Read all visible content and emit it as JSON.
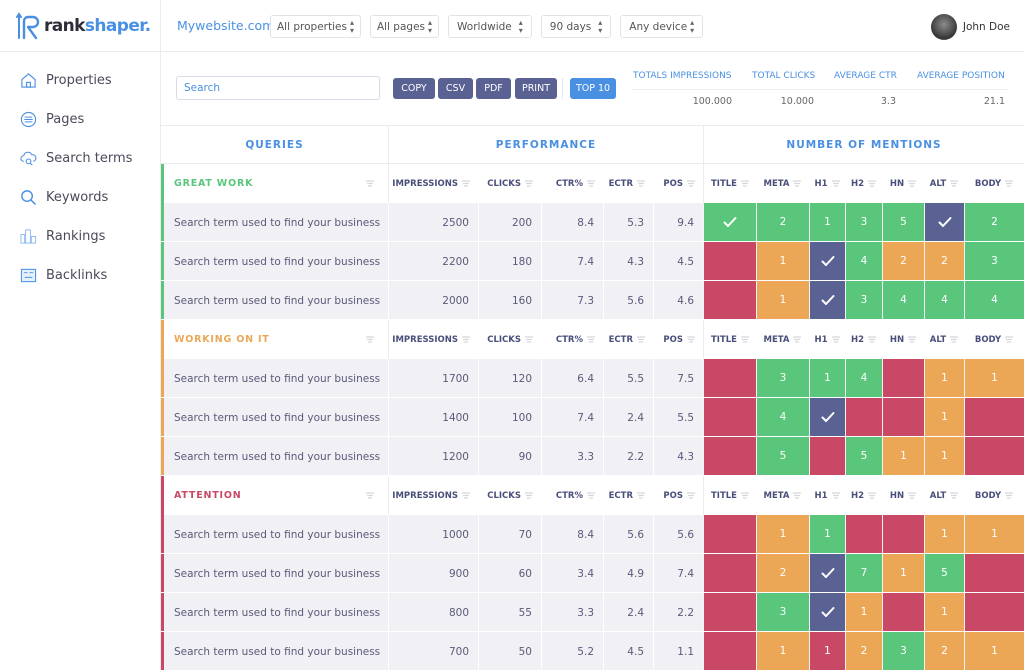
{
  "app": {
    "logo_rank": "rank",
    "logo_shaper": "shaper.",
    "site_name": "Mywebsite.com",
    "filters": [
      {
        "label": "All properties"
      },
      {
        "label": "All pages"
      },
      {
        "label": "Worldwide"
      },
      {
        "label": "90 days"
      },
      {
        "label": "Any device"
      }
    ],
    "user_name": "John Doe"
  },
  "sidebar": {
    "items": [
      {
        "label": "Properties",
        "icon": "home-icon"
      },
      {
        "label": "Pages",
        "icon": "list-icon"
      },
      {
        "label": "Search terms",
        "icon": "cloud-search-icon"
      },
      {
        "label": "Keywords",
        "icon": "search-icon"
      },
      {
        "label": "Rankings",
        "icon": "rankings-icon"
      },
      {
        "label": "Backlinks",
        "icon": "backlinks-icon"
      }
    ]
  },
  "toolbar": {
    "search_placeholder": "Search",
    "buttons": [
      "COPY",
      "CSV",
      "PDF",
      "PRINT"
    ],
    "top10": "TOP 10"
  },
  "stats": [
    {
      "label": "TOTALS IMPRESSIONS",
      "value": "100.000"
    },
    {
      "label": "TOTAL CLICKS",
      "value": "10.000"
    },
    {
      "label": "AVERAGE CTR",
      "value": "3.3"
    },
    {
      "label": "AVERAGE POSITION",
      "value": "21.1"
    }
  ],
  "table": {
    "groups": [
      "QUERIES",
      "PERFORMANCE",
      "NUMBER OF MENTIONS"
    ],
    "perf_columns": [
      "IMPRESSIONS",
      "CLICKS",
      "CTR%",
      "ECTR",
      "POS"
    ],
    "mention_columns": [
      "TITLE",
      "META",
      "H1",
      "H2",
      "HN",
      "ALT",
      "BODY"
    ],
    "colors": {
      "green": "#5ac67c",
      "orange": "#eba755",
      "red": "#c84866",
      "navy": "#5a6294"
    },
    "sections": [
      {
        "title": "GREAT WORK",
        "color": "#5ac67c",
        "rows": [
          {
            "query": "Search term used to find your business",
            "impressions": "2500",
            "clicks": "200",
            "ctr": "8.4",
            "ectr": "5.3",
            "pos": "9.4",
            "mentions": [
              {
                "s": "green",
                "v": "✓"
              },
              {
                "s": "green",
                "v": "2"
              },
              {
                "s": "green",
                "v": "1"
              },
              {
                "s": "green",
                "v": "3"
              },
              {
                "s": "green",
                "v": "5"
              },
              {
                "s": "navy",
                "v": "✓"
              },
              {
                "s": "green",
                "v": "2"
              }
            ]
          },
          {
            "query": "Search term used to find your business",
            "impressions": "2200",
            "clicks": "180",
            "ctr": "7.4",
            "ectr": "4.3",
            "pos": "4.5",
            "mentions": [
              {
                "s": "red",
                "v": ""
              },
              {
                "s": "orange",
                "v": "1"
              },
              {
                "s": "navy",
                "v": "✓"
              },
              {
                "s": "green",
                "v": "4"
              },
              {
                "s": "orange",
                "v": "2"
              },
              {
                "s": "orange",
                "v": "2"
              },
              {
                "s": "green",
                "v": "3"
              }
            ]
          },
          {
            "query": "Search term used to find your business",
            "impressions": "2000",
            "clicks": "160",
            "ctr": "7.3",
            "ectr": "5.6",
            "pos": "4.6",
            "mentions": [
              {
                "s": "red",
                "v": ""
              },
              {
                "s": "orange",
                "v": "1"
              },
              {
                "s": "navy",
                "v": "✓"
              },
              {
                "s": "green",
                "v": "3"
              },
              {
                "s": "green",
                "v": "4"
              },
              {
                "s": "green",
                "v": "4"
              },
              {
                "s": "green",
                "v": "4"
              }
            ]
          }
        ]
      },
      {
        "title": "WORKING ON IT",
        "color": "#eba755",
        "rows": [
          {
            "query": "Search term used to find your business",
            "impressions": "1700",
            "clicks": "120",
            "ctr": "6.4",
            "ectr": "5.5",
            "pos": "7.5",
            "mentions": [
              {
                "s": "red",
                "v": ""
              },
              {
                "s": "green",
                "v": "3"
              },
              {
                "s": "green",
                "v": "1"
              },
              {
                "s": "green",
                "v": "4"
              },
              {
                "s": "red",
                "v": ""
              },
              {
                "s": "orange",
                "v": "1"
              },
              {
                "s": "orange",
                "v": "1"
              }
            ]
          },
          {
            "query": "Search term used to find your business",
            "impressions": "1400",
            "clicks": "100",
            "ctr": "7.4",
            "ectr": "2.4",
            "pos": "5.5",
            "mentions": [
              {
                "s": "red",
                "v": ""
              },
              {
                "s": "green",
                "v": "4"
              },
              {
                "s": "navy",
                "v": "✓"
              },
              {
                "s": "red",
                "v": ""
              },
              {
                "s": "red",
                "v": ""
              },
              {
                "s": "orange",
                "v": "1"
              },
              {
                "s": "red",
                "v": ""
              }
            ]
          },
          {
            "query": "Search term used to find your business",
            "impressions": "1200",
            "clicks": "90",
            "ctr": "3.3",
            "ectr": "2.2",
            "pos": "4.3",
            "mentions": [
              {
                "s": "red",
                "v": ""
              },
              {
                "s": "green",
                "v": "5"
              },
              {
                "s": "red",
                "v": ""
              },
              {
                "s": "green",
                "v": "5"
              },
              {
                "s": "orange",
                "v": "1"
              },
              {
                "s": "orange",
                "v": "1"
              },
              {
                "s": "red",
                "v": ""
              }
            ]
          }
        ]
      },
      {
        "title": "ATTENTION",
        "color": "#c84866",
        "rows": [
          {
            "query": "Search term used to find your business",
            "impressions": "1000",
            "clicks": "70",
            "ctr": "8.4",
            "ectr": "5.6",
            "pos": "5.6",
            "mentions": [
              {
                "s": "red",
                "v": ""
              },
              {
                "s": "orange",
                "v": "1"
              },
              {
                "s": "green",
                "v": "1"
              },
              {
                "s": "red",
                "v": ""
              },
              {
                "s": "red",
                "v": ""
              },
              {
                "s": "orange",
                "v": "1"
              },
              {
                "s": "orange",
                "v": "1"
              }
            ]
          },
          {
            "query": "Search term used to find your business",
            "impressions": "900",
            "clicks": "60",
            "ctr": "3.4",
            "ectr": "4.9",
            "pos": "7.4",
            "mentions": [
              {
                "s": "red",
                "v": ""
              },
              {
                "s": "orange",
                "v": "2"
              },
              {
                "s": "navy",
                "v": "✓"
              },
              {
                "s": "green",
                "v": "7"
              },
              {
                "s": "orange",
                "v": "1"
              },
              {
                "s": "green",
                "v": "5"
              },
              {
                "s": "red",
                "v": ""
              }
            ]
          },
          {
            "query": "Search term used to find your business",
            "impressions": "800",
            "clicks": "55",
            "ctr": "3.3",
            "ectr": "2.4",
            "pos": "2.2",
            "mentions": [
              {
                "s": "red",
                "v": ""
              },
              {
                "s": "green",
                "v": "3"
              },
              {
                "s": "navy",
                "v": "✓"
              },
              {
                "s": "orange",
                "v": "1"
              },
              {
                "s": "red",
                "v": ""
              },
              {
                "s": "orange",
                "v": "1"
              },
              {
                "s": "red",
                "v": ""
              }
            ]
          },
          {
            "query": "Search term used to find your business",
            "impressions": "700",
            "clicks": "50",
            "ctr": "5.2",
            "ectr": "4.5",
            "pos": "1.1",
            "mentions": [
              {
                "s": "red",
                "v": ""
              },
              {
                "s": "orange",
                "v": "1"
              },
              {
                "s": "red",
                "v": "1"
              },
              {
                "s": "orange",
                "v": "2"
              },
              {
                "s": "green",
                "v": "3"
              },
              {
                "s": "orange",
                "v": "2"
              },
              {
                "s": "orange",
                "v": "1"
              }
            ]
          }
        ]
      }
    ]
  }
}
